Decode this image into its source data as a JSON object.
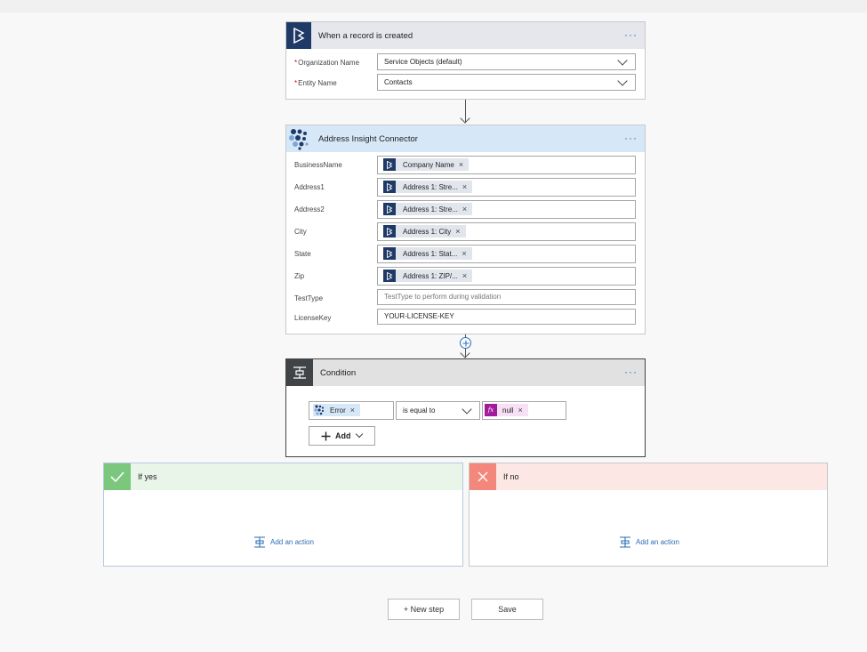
{
  "trigger": {
    "title": "When a record is created",
    "fields": [
      {
        "label": "Organization Name",
        "required": "*",
        "value": "Service Objects (default)"
      },
      {
        "label": "Entity Name",
        "required": "*",
        "value": "Contacts"
      }
    ]
  },
  "connector": {
    "title": "Address Insight Connector",
    "fields": [
      {
        "label": "BusinessName",
        "token": "Company Name"
      },
      {
        "label": "Address1",
        "token": "Address 1: Stre..."
      },
      {
        "label": "Address2",
        "token": "Address 1: Stre..."
      },
      {
        "label": "City",
        "token": "Address 1: City"
      },
      {
        "label": "State",
        "token": "Address 1: Stat..."
      },
      {
        "label": "Zip",
        "token": "Address 1: ZIP/..."
      },
      {
        "label": "TestType",
        "placeholder": "TestType to perform during validation"
      },
      {
        "label": "LicenseKey",
        "value": "YOUR-LICENSE-KEY"
      }
    ]
  },
  "condition": {
    "title": "Condition",
    "left_token": "Error",
    "operator": "is equal to",
    "fx_symbol": "fx",
    "right_token": "null",
    "add_label": "Add"
  },
  "branches": {
    "yes": {
      "title": "If yes",
      "add_action": "Add an action"
    },
    "no": {
      "title": "If no",
      "add_action": "Add an action"
    }
  },
  "footer": {
    "new_step": "+ New step",
    "save": "Save"
  },
  "ellipsis": "···",
  "remove_symbol": "×",
  "icons": {
    "dynamics": "dynamics-icon",
    "connector": "dots-logo-icon",
    "condition": "condition-icon",
    "check": "check-icon",
    "close": "close-icon",
    "add_action": "add-action-icon",
    "plus": "plus-icon"
  },
  "colors": {
    "dynamics_blue": "#1f3a67",
    "trigger_header": "#e5e7ec",
    "connector_header": "#d6e8f7",
    "condition_dark": "#404447",
    "yes_green": "#7bc77e",
    "yes_header": "#eaf5ea",
    "no_red": "#f4877b",
    "no_header": "#fde7e5",
    "fx_purple": "#a31a9b",
    "link_blue": "#2a6db5"
  }
}
